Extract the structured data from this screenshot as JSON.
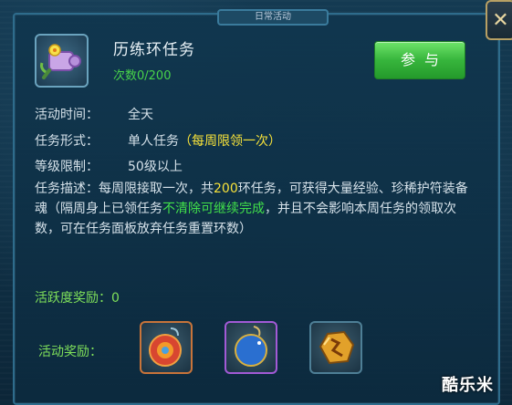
{
  "header": {
    "tab_label": "日常活动",
    "close_label": "✕"
  },
  "quest": {
    "title": "历练环任务",
    "count_label": "次数0/200",
    "join_label": "参与"
  },
  "info": {
    "time_label": "活动时间：",
    "time_value": "全天",
    "form_label": "任务形式：",
    "form_value": "单人任务",
    "form_note": "（每周限领一次）",
    "level_label": "等级限制：",
    "level_value": "50级以上"
  },
  "description": {
    "label": "任务描述：",
    "text_a": "每周限接取一次，共",
    "highlight_count": "200",
    "text_b": "环任务，可获得大量经验、珍稀护符装备魂（隔周身上已领任务",
    "highlight_keep": "不清除可继续完成",
    "text_c": "，并且不会影响本周任务的领取次数，可在任务面板放弃任务重置环数）"
  },
  "activity": {
    "label": "活跃度奖励：",
    "value": "0"
  },
  "rewards": {
    "label": "活动奖励：",
    "items": [
      {
        "icon": "red-amulet-icon"
      },
      {
        "icon": "blue-moon-amulet-icon"
      },
      {
        "icon": "gold-rune-stone-icon"
      }
    ]
  },
  "watermark": "酷乐米",
  "colors": {
    "accent_green": "#41e04a",
    "highlight_yellow": "#f7e23a",
    "button_green": "#37b53c"
  }
}
